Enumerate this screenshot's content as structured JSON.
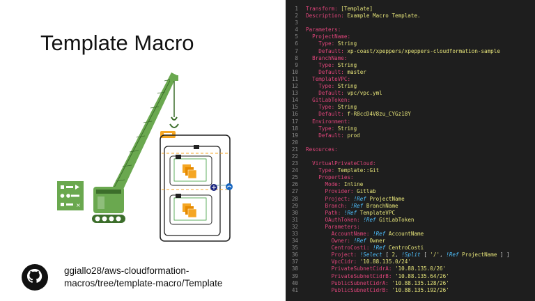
{
  "slide": {
    "title": "Template Macro",
    "repo_line1": "ggiallo28/aws-cloudformation-",
    "repo_line2": "macros/tree/template-macro/Template"
  },
  "icons": {
    "github": "github-icon",
    "crane": "crane-icon",
    "macro_box": "macro-icon",
    "vpc_template": "vpc-diagram-icon",
    "checklist": "checklist-icon"
  },
  "colors": {
    "crane_green": "#6aa84f",
    "crane_dark": "#3c6e2b",
    "code_bg": "#1e1e1e",
    "key": "#e0457b",
    "value": "#e7e57a",
    "tag": "#4fc1ff",
    "line_number": "#8a8a8a"
  },
  "code": {
    "lines": [
      [
        {
          "c": "k",
          "s": "Transform: "
        },
        {
          "c": "v",
          "s": "[Template]"
        }
      ],
      [
        {
          "c": "k",
          "s": "Description: "
        },
        {
          "c": "v",
          "s": "Example Macro Template."
        }
      ],
      [],
      [
        {
          "c": "k",
          "s": "Parameters:"
        }
      ],
      [
        {
          "c": "p",
          "s": "  "
        },
        {
          "c": "k",
          "s": "ProjectName:"
        }
      ],
      [
        {
          "c": "p",
          "s": "    "
        },
        {
          "c": "k",
          "s": "Type: "
        },
        {
          "c": "v",
          "s": "String"
        }
      ],
      [
        {
          "c": "p",
          "s": "    "
        },
        {
          "c": "k",
          "s": "Default: "
        },
        {
          "c": "v",
          "s": "xp-coast/xpeppers/xpeppers-cloudformation-sample"
        }
      ],
      [
        {
          "c": "p",
          "s": "  "
        },
        {
          "c": "k",
          "s": "BranchName:"
        }
      ],
      [
        {
          "c": "p",
          "s": "    "
        },
        {
          "c": "k",
          "s": "Type: "
        },
        {
          "c": "v",
          "s": "String"
        }
      ],
      [
        {
          "c": "p",
          "s": "    "
        },
        {
          "c": "k",
          "s": "Default: "
        },
        {
          "c": "v",
          "s": "master"
        }
      ],
      [
        {
          "c": "p",
          "s": "  "
        },
        {
          "c": "k",
          "s": "TemplateVPC:"
        }
      ],
      [
        {
          "c": "p",
          "s": "    "
        },
        {
          "c": "k",
          "s": "Type: "
        },
        {
          "c": "v",
          "s": "String"
        }
      ],
      [
        {
          "c": "p",
          "s": "    "
        },
        {
          "c": "k",
          "s": "Default: "
        },
        {
          "c": "v",
          "s": "vpc/vpc.yml"
        }
      ],
      [
        {
          "c": "p",
          "s": "  "
        },
        {
          "c": "k",
          "s": "GitLabToken:"
        }
      ],
      [
        {
          "c": "p",
          "s": "    "
        },
        {
          "c": "k",
          "s": "Type: "
        },
        {
          "c": "v",
          "s": "String"
        }
      ],
      [
        {
          "c": "p",
          "s": "    "
        },
        {
          "c": "k",
          "s": "Default: "
        },
        {
          "c": "v",
          "s": "f-R8ccD4V8zu_CYGz18Y"
        }
      ],
      [
        {
          "c": "p",
          "s": "  "
        },
        {
          "c": "k",
          "s": "Environment:"
        }
      ],
      [
        {
          "c": "p",
          "s": "    "
        },
        {
          "c": "k",
          "s": "Type: "
        },
        {
          "c": "v",
          "s": "String"
        }
      ],
      [
        {
          "c": "p",
          "s": "    "
        },
        {
          "c": "k",
          "s": "Default: "
        },
        {
          "c": "v",
          "s": "prod"
        }
      ],
      [],
      [
        {
          "c": "k",
          "s": "Resources:"
        }
      ],
      [],
      [
        {
          "c": "p",
          "s": "  "
        },
        {
          "c": "k",
          "s": "VirtualPrivateCloud:"
        }
      ],
      [
        {
          "c": "p",
          "s": "    "
        },
        {
          "c": "k",
          "s": "Type: "
        },
        {
          "c": "v",
          "s": "Template::Git"
        }
      ],
      [
        {
          "c": "p",
          "s": "    "
        },
        {
          "c": "k",
          "s": "Properties:"
        }
      ],
      [
        {
          "c": "p",
          "s": "      "
        },
        {
          "c": "k",
          "s": "Mode: "
        },
        {
          "c": "v",
          "s": "Inline"
        }
      ],
      [
        {
          "c": "p",
          "s": "      "
        },
        {
          "c": "k",
          "s": "Provider: "
        },
        {
          "c": "v",
          "s": "Gitlab"
        }
      ],
      [
        {
          "c": "p",
          "s": "      "
        },
        {
          "c": "k",
          "s": "Project: "
        },
        {
          "c": "t",
          "s": "!Ref "
        },
        {
          "c": "v",
          "s": "ProjectName"
        }
      ],
      [
        {
          "c": "p",
          "s": "      "
        },
        {
          "c": "k",
          "s": "Branch: "
        },
        {
          "c": "t",
          "s": "!Ref "
        },
        {
          "c": "v",
          "s": "BranchName"
        }
      ],
      [
        {
          "c": "p",
          "s": "      "
        },
        {
          "c": "k",
          "s": "Path: "
        },
        {
          "c": "t",
          "s": "!Ref "
        },
        {
          "c": "v",
          "s": "TemplateVPC"
        }
      ],
      [
        {
          "c": "p",
          "s": "      "
        },
        {
          "c": "k",
          "s": "OAuthToken: "
        },
        {
          "c": "t",
          "s": "!Ref "
        },
        {
          "c": "v",
          "s": "GitLabToken"
        }
      ],
      [
        {
          "c": "p",
          "s": "      "
        },
        {
          "c": "k",
          "s": "Parameters:"
        }
      ],
      [
        {
          "c": "p",
          "s": "        "
        },
        {
          "c": "k",
          "s": "AccountName: "
        },
        {
          "c": "t",
          "s": "!Ref "
        },
        {
          "c": "v",
          "s": "AccountName"
        }
      ],
      [
        {
          "c": "p",
          "s": "        "
        },
        {
          "c": "k",
          "s": "Owner: "
        },
        {
          "c": "t",
          "s": "!Ref "
        },
        {
          "c": "v",
          "s": "Owner"
        }
      ],
      [
        {
          "c": "p",
          "s": "        "
        },
        {
          "c": "k",
          "s": "CentroCosti: "
        },
        {
          "c": "t",
          "s": "!Ref "
        },
        {
          "c": "v",
          "s": "CentroCosti"
        }
      ],
      [
        {
          "c": "p",
          "s": "        "
        },
        {
          "c": "k",
          "s": "Project: "
        },
        {
          "c": "t",
          "s": "!Select "
        },
        {
          "c": "p",
          "s": "[ "
        },
        {
          "c": "v",
          "s": "2"
        },
        {
          "c": "p",
          "s": ", "
        },
        {
          "c": "t",
          "s": "!Split "
        },
        {
          "c": "p",
          "s": "[ "
        },
        {
          "c": "v",
          "s": "'/'"
        },
        {
          "c": "p",
          "s": ", "
        },
        {
          "c": "t",
          "s": "!Ref "
        },
        {
          "c": "v",
          "s": "ProjectName"
        },
        {
          "c": "p",
          "s": " ] ]"
        }
      ],
      [
        {
          "c": "p",
          "s": "        "
        },
        {
          "c": "k",
          "s": "VpcCidr: "
        },
        {
          "c": "v",
          "s": "'10.88.135.0/24'"
        }
      ],
      [
        {
          "c": "p",
          "s": "        "
        },
        {
          "c": "k",
          "s": "PrivateSubnetCidrA: "
        },
        {
          "c": "v",
          "s": "'10.88.135.0/26'"
        }
      ],
      [
        {
          "c": "p",
          "s": "        "
        },
        {
          "c": "k",
          "s": "PrivateSubnetCidrB: "
        },
        {
          "c": "v",
          "s": "'10.88.135.64/26'"
        }
      ],
      [
        {
          "c": "p",
          "s": "        "
        },
        {
          "c": "k",
          "s": "PublicSubnetCidrA: "
        },
        {
          "c": "v",
          "s": "'10.88.135.128/26'"
        }
      ],
      [
        {
          "c": "p",
          "s": "        "
        },
        {
          "c": "k",
          "s": "PublicSubnetCidrB: "
        },
        {
          "c": "v",
          "s": "'10.88.135.192/26'"
        }
      ]
    ]
  }
}
